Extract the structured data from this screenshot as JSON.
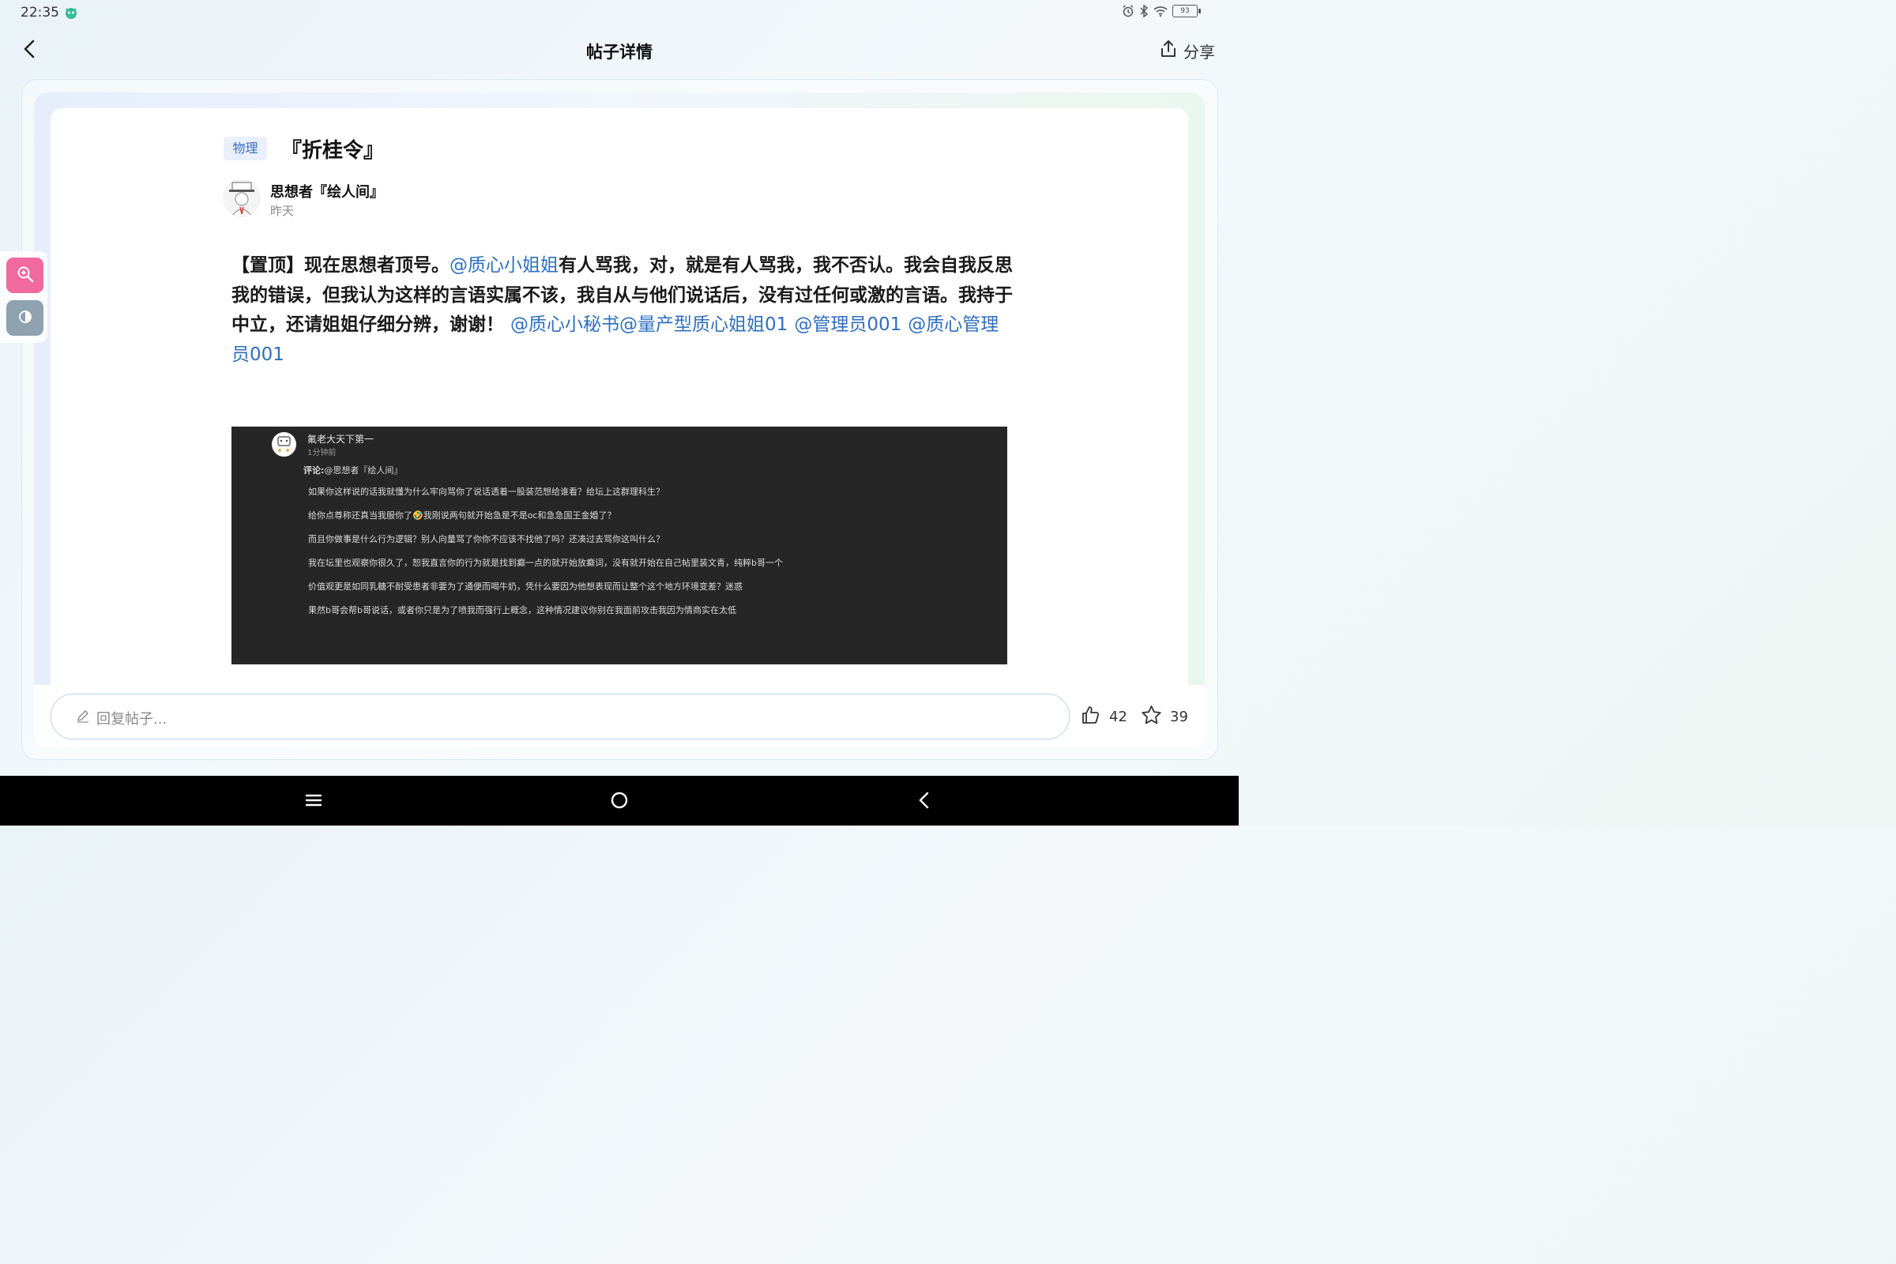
{
  "status_bar": {
    "time": "22:35",
    "battery": "93",
    "icons": [
      "alarm-icon",
      "bluetooth-icon",
      "wifi-icon",
      "battery-icon"
    ]
  },
  "header": {
    "title": "帖子详情",
    "share_label": "分享"
  },
  "post": {
    "tag": "物理",
    "title": "『折桂令』",
    "author": "思想者『绘人间』",
    "time": "昨天",
    "body": {
      "seg1": "【置顶】现在思想者顶号。",
      "mention1": "@质心小姐姐",
      "seg2": "有人骂我，对，就是有人骂我，我不否认。我会自我反思我的错误，但我认为这样的言语实属不该，我自从与他们说话后，没有过任何或激的言语。我持于中立，还请姐姐仔细分辨，谢谢！",
      "mention2": "@质心小秘书",
      "mention3": "@量产型质心姐姐01",
      "mention4": "@管理员001",
      "mention5": "@质心管理员001"
    }
  },
  "screenshot": {
    "name": "氟老大天下第一",
    "time": "1分钟前",
    "reply_label": "评论:",
    "reply_to": "@思想者『绘人间』",
    "lines": [
      "如果你这样说的话我就懂为什么牢向骂你了说话透着一股装范想给谁看？给坛上这群理科生？",
      "给你点尊称还真当我服你了🤣我刚说两句就开始急是不是oc和急急国王金婚了？",
      "而且你做事是什么行为逻辑？别人向量骂了你你不应该不找他了吗？还凑过去骂你这叫什么？",
      "我在坛里也观察你很久了，恕我直言你的行为就是找到癫一点的就开始放癫词，没有就开始在自己帖里装文青，纯粹b哥一个",
      "价值观更是如同乳糖不耐受患者非要为了通便而喝牛奶，凭什么要因为他想表现而让整个这个地方环境变差？迷惑",
      "果然b哥会帮b哥说话，或者你只是为了喷我而强行上概念，这种情况建议你别在我面前攻击我因为情商实在太低"
    ]
  },
  "reply_bar": {
    "placeholder": "回复帖子...",
    "likes": "42",
    "favorites": "39"
  },
  "colors": {
    "accent_blue": "#2f6fc0",
    "tag_bg": "#e9f0fb",
    "zoom_pink": "#f06aa0",
    "contrast_gray": "#8ea2b0"
  }
}
